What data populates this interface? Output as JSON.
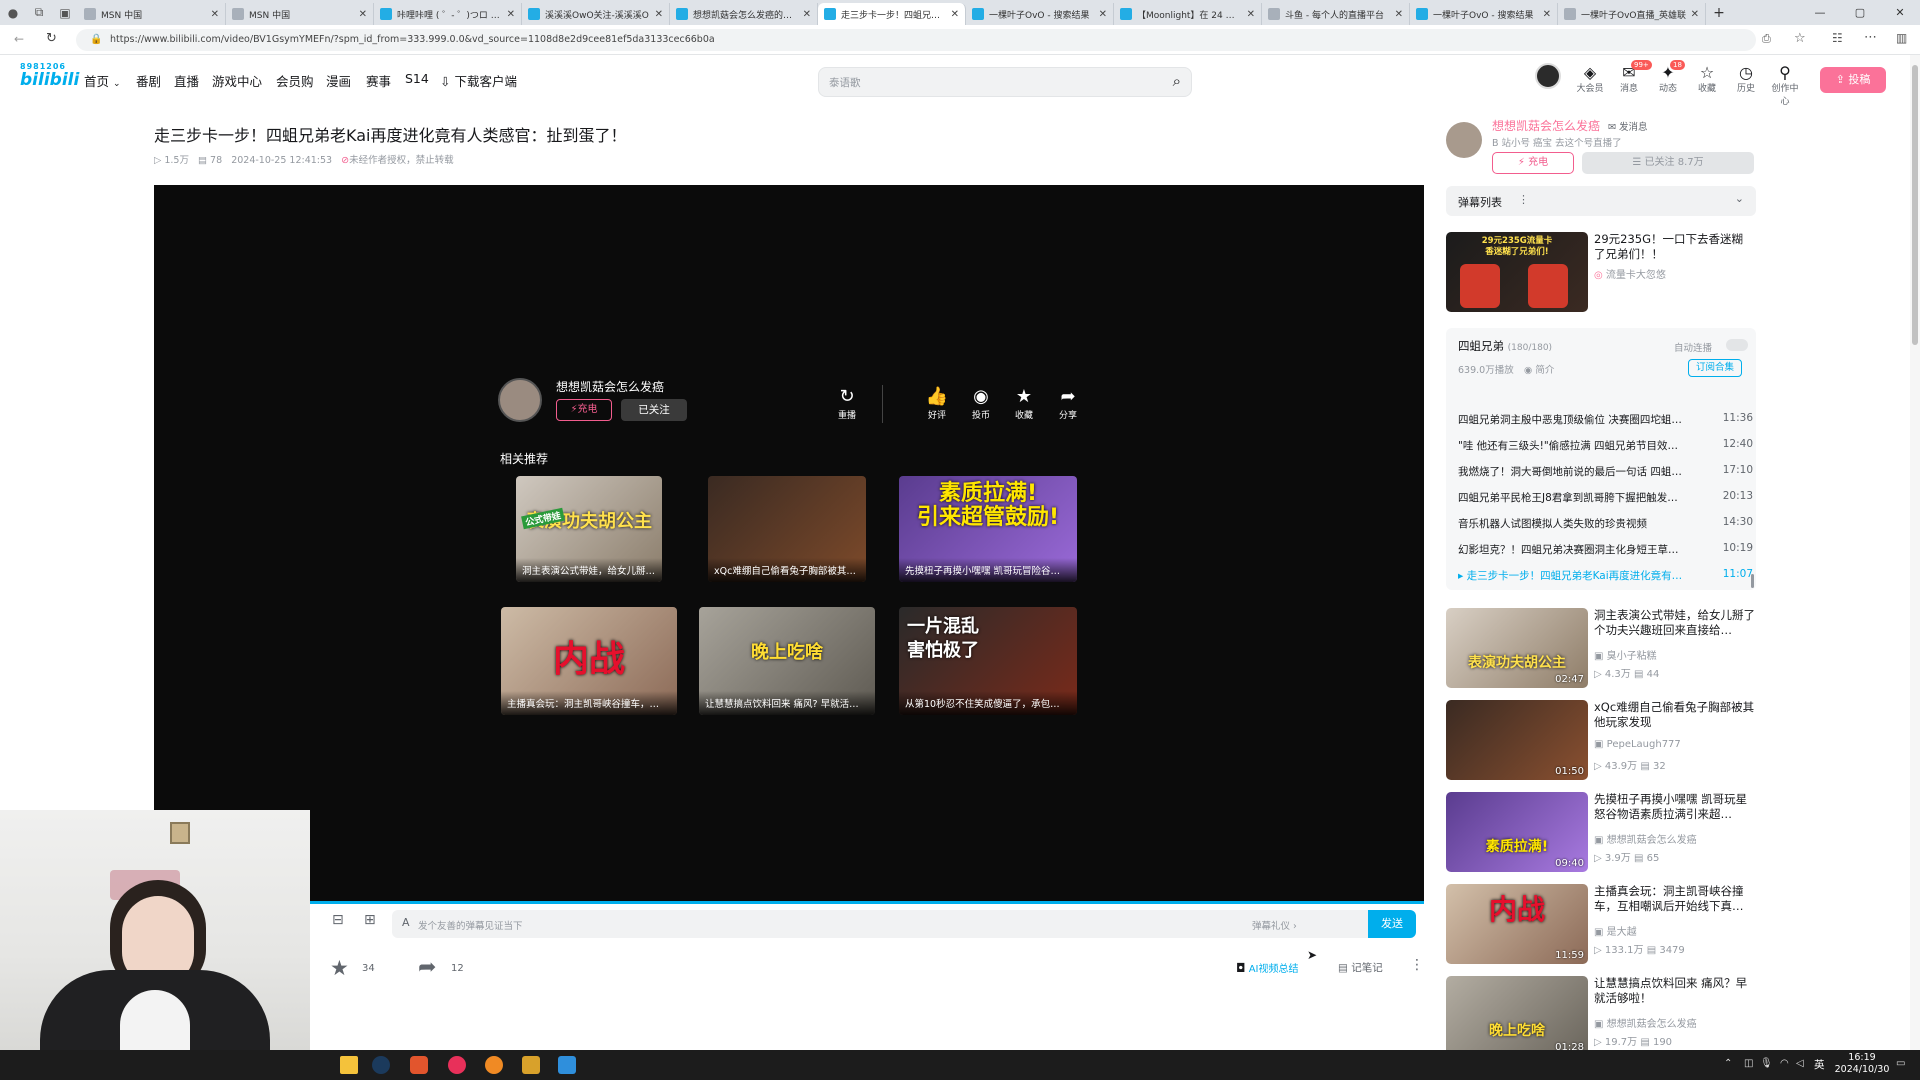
{
  "browser": {
    "tabs": [
      {
        "title": "MSN 中国",
        "bili": false
      },
      {
        "title": "MSN 中国",
        "bili": false
      },
      {
        "title": "咔哩咔哩 ( ゜- ゜)つロ 干杯",
        "bili": true
      },
      {
        "title": "溪溪溪OwO关注-溪溪溪O",
        "bili": true
      },
      {
        "title": "想想凯菇会怎么发癌的个人",
        "bili": true
      },
      {
        "title": "走三步卡一步！四蛆兄弟老",
        "bili": true,
        "active": true
      },
      {
        "title": "一棵叶子OvO - 搜索结果",
        "bili": true
      },
      {
        "title": "【Moonlight】在 24 小时",
        "bili": true
      },
      {
        "title": "斗鱼 - 每个人的直播平台",
        "bili": false
      },
      {
        "title": "一棵叶子OvO - 搜索结果",
        "bili": true
      },
      {
        "title": "一棵叶子OvO直播_英雄联",
        "bili": false
      }
    ],
    "url": "https://www.bilibili.com/video/BV1GsymYMEFn/?spm_id_from=333.999.0.0&vd_source=1108d8e2d9cee81ef5da3133cec66b0a"
  },
  "header": {
    "logo_small": "8981206",
    "logo": "bilibili",
    "nav": [
      "首页",
      "番剧",
      "直播",
      "游戏中心",
      "会员购",
      "漫画",
      "赛事",
      "S14",
      "下载客户端"
    ],
    "search_placeholder": "泰语歌",
    "icons": [
      {
        "label": "大会员",
        "icon": "vip-icon",
        "glyph": "◈"
      },
      {
        "label": "消息",
        "icon": "message-icon",
        "glyph": "✉",
        "badge": "99+"
      },
      {
        "label": "动态",
        "icon": "dynamic-icon",
        "glyph": "✦",
        "badge": "18"
      },
      {
        "label": "收藏",
        "icon": "star-icon",
        "glyph": "☆"
      },
      {
        "label": "历史",
        "icon": "history-icon",
        "glyph": "◷"
      },
      {
        "label": "创作中心",
        "icon": "creator-icon",
        "glyph": "⚲"
      }
    ],
    "upload_label": "投稿"
  },
  "video": {
    "title": "走三步卡一步！四蛆兄弟老Kai再度进化竟有人类感官：扯到蛋了！",
    "views": "1.5万",
    "danmaku": "78",
    "date": "2024-10-25 12:41:53",
    "rights": "未经作者授权，禁止转载"
  },
  "endscreen": {
    "uploader": "想想凯菇会怎么发癌",
    "charge": "充电",
    "followed": "已关注",
    "replay": "重播",
    "like": "好评",
    "coin": "投币",
    "fav": "收藏",
    "share": "分享",
    "rec_title": "相关推荐",
    "recs": [
      {
        "caption": "洞主表演公式带娃，给女儿掰了个…",
        "overlay": "表演功夫胡公主",
        "tag": "公式带娃"
      },
      {
        "caption": "xQc难绷自己偷看兔子胸部被其他…",
        "overlay": ""
      },
      {
        "caption": "先摸杻子再摸小嘿嘿 凯哥玩冒险谷…",
        "overlay": "素质拉满!\n引来超管鼓励!"
      },
      {
        "caption": "主播真会玩：洞主凯哥峡谷撞车，…",
        "overlay": "内战"
      },
      {
        "caption": "让慧慧搞点饮料回来 痛风? 早就活…",
        "overlay": "晚上吃啥"
      },
      {
        "caption": "从第10秒忍不住笑成傻逼了，承包…",
        "overlay": "一片混乱\n害怕极了"
      }
    ]
  },
  "danmaku_bar": {
    "placeholder": "发个友善的弹幕见证当下",
    "etiquette": "弹幕礼仪",
    "send": "发送"
  },
  "toolbar": {
    "fav_count": "34",
    "share_count": "12",
    "ai_summary": "AI视频总结",
    "note": "记笔记"
  },
  "uploader": {
    "name": "想想凯菇会怎么发癌",
    "message": "发消息",
    "desc": "B 站小号 癌宝 去这个号直播了",
    "charge": "充电",
    "followed": "已关注 8.7万"
  },
  "danmaku_list": {
    "label": "弹幕列表"
  },
  "ad": {
    "title": "29元235G！一口下去香迷糊了兄弟们！！",
    "source": "流量卡大忽悠",
    "overlay": "29元235G流量卡\n香迷糊了兄弟们!"
  },
  "playlist": {
    "title": "四蛆兄弟",
    "count": "(180/180)",
    "autoplay": "自动连播",
    "plays": "639.0万播放",
    "intro": "简介",
    "subscribe": "订阅合集",
    "episodes": [
      {
        "name": "四蛆兄弟洞主殷中恶鬼顶级偷位 决赛圈四坨蛆…",
        "dur": "11:36"
      },
      {
        "name": "\"哇 他还有三级头!\"偷感拉满 四蛆兄弟节目效…",
        "dur": "12:40"
      },
      {
        "name": "我燃烧了！洞大哥倒地前说的最后一句话 四蛆…",
        "dur": "17:10"
      },
      {
        "name": "四蛆兄弟平民枪王J8君拿到凯哥胯下握把触发…",
        "dur": "20:13"
      },
      {
        "name": "音乐机器人试图模拟人类失败的珍贵视频",
        "dur": "14:30"
      },
      {
        "name": "幻影坦克？！四蛆兄弟决赛圈洞主化身短王草…",
        "dur": "10:19"
      },
      {
        "name": "走三步卡一步！四蛆兄弟老Kai再度进化竟有…",
        "dur": "11:07",
        "current": true
      }
    ]
  },
  "side_recs": [
    {
      "title": "洞主表演公式带娃，给女儿掰了个功夫兴趣班回来直接给…",
      "up": "臭小子粘糕",
      "views": "4.3万",
      "dm": "44",
      "dur": "02:47",
      "overlay": "表演功夫胡公主"
    },
    {
      "title": "xQc难绷自己偷看兔子胸部被其他玩家发现",
      "up": "PepeLaugh777",
      "views": "43.9万",
      "dm": "32",
      "dur": "01:50",
      "overlay": ""
    },
    {
      "title": "先摸杻子再摸小嘿嘿 凯哥玩星怒谷物语素质拉满引来超…",
      "up": "想想凯菇会怎么发癌",
      "views": "3.9万",
      "dm": "65",
      "dur": "09:40",
      "overlay": "素质拉满!"
    },
    {
      "title": "主播真会玩：洞主凯哥峡谷撞车，互相嘲讽后开始线下真…",
      "up": "是大越",
      "views": "133.1万",
      "dm": "3479",
      "dur": "11:59",
      "overlay": "内战"
    },
    {
      "title": "让慧慧搞点饮料回来 痛风？早就活够啦！",
      "up": "想想凯菇会怎么发癌",
      "views": "19.7万",
      "dm": "190",
      "dur": "01:28",
      "overlay": "晚上吃啥"
    }
  ],
  "system": {
    "time": "16:19",
    "date": "2024/10/30",
    "ime": "英"
  },
  "colors": {
    "brand": "#00aeec",
    "pink": "#fb7299",
    "charge": "#f25d8e"
  }
}
